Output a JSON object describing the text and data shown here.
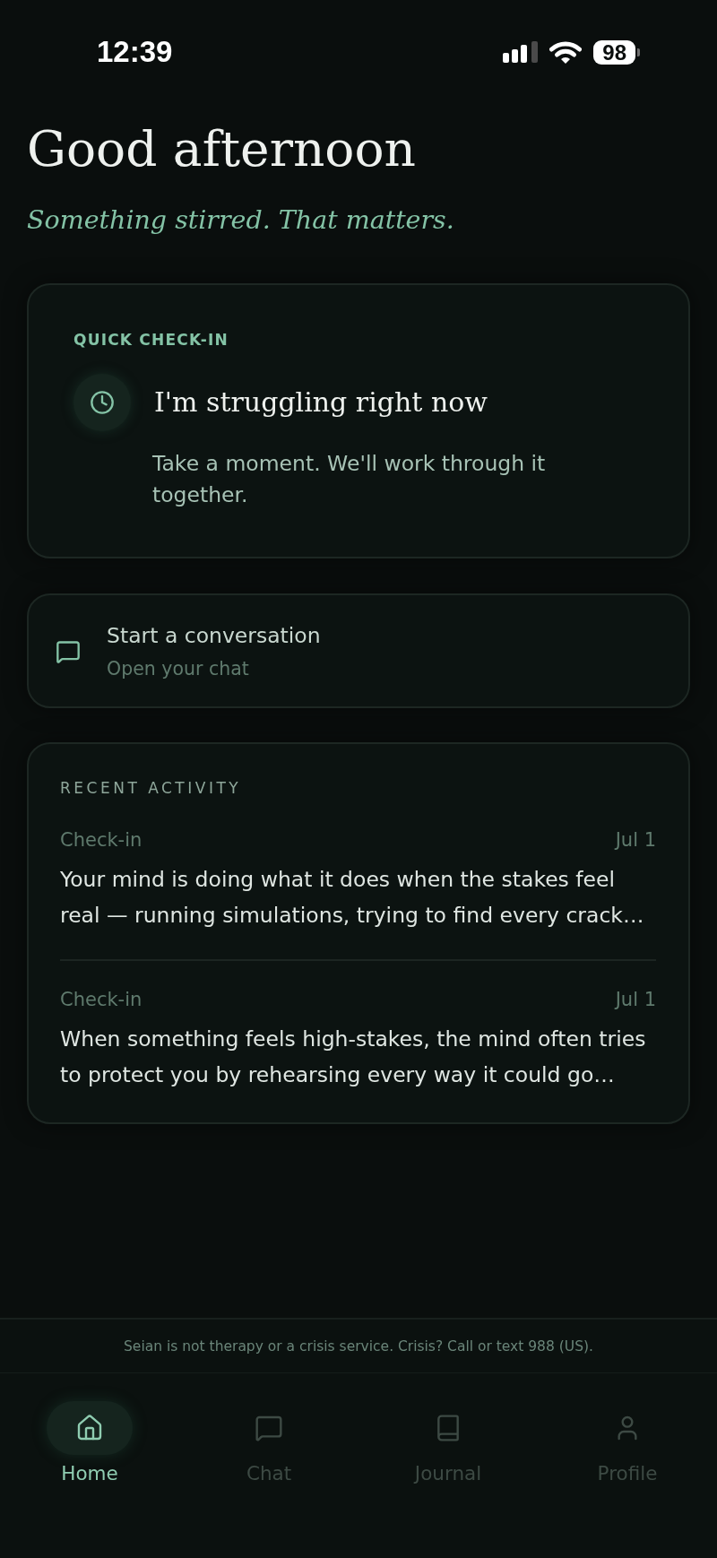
{
  "status_bar": {
    "time": "12:39",
    "battery": "98"
  },
  "header": {
    "title": "Good afternoon",
    "subtitle": "Something stirred. That matters."
  },
  "quick_check_in": {
    "label": "QUICK CHECK-IN",
    "title": "I'm struggling right now",
    "description": "Take a moment. We'll work through it together."
  },
  "conversation": {
    "title": "Start a conversation",
    "subtitle": "Open your chat"
  },
  "recent_activity": {
    "title": "RECENT ACTIVITY",
    "items": [
      {
        "label": "Check-in",
        "date": "Jul 1",
        "text": "Your mind is doing what it does when the stakes feel real — running simulations, trying to find every crack…"
      },
      {
        "label": "Check-in",
        "date": "Jul 1",
        "text": "When something feels high-stakes, the mind often tries to protect you by rehearsing every way it could go…"
      }
    ]
  },
  "disclaimer": "Seian is not therapy or a crisis service. Crisis? Call or text 988 (US).",
  "tab_bar": {
    "tabs": [
      {
        "kind": "home",
        "label": "Home",
        "selected": true
      },
      {
        "kind": "chat",
        "label": "Chat",
        "selected": false
      },
      {
        "kind": "journal",
        "label": "Journal",
        "selected": false
      },
      {
        "kind": "profile",
        "label": "Profile",
        "selected": false
      }
    ]
  }
}
